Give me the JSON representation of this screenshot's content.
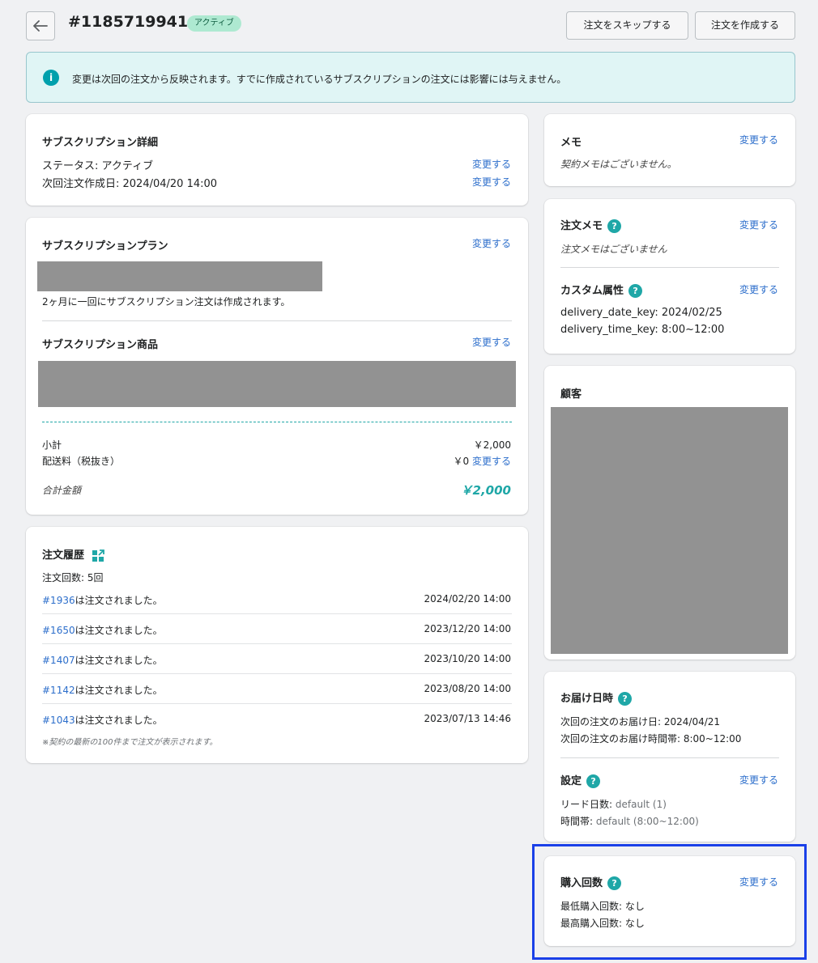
{
  "header": {
    "back_icon": "arrow-left-icon",
    "order_id": "#11857199414",
    "status_badge": "アクティブ",
    "skip_button": "注文をスキップする",
    "create_button": "注文を作成する"
  },
  "banner": {
    "icon": "info-icon",
    "text": "変更は次回の注文から反映されます。すでに作成されているサブスクリプションの注文には影響には与えません。"
  },
  "details": {
    "title": "サブスクリプション詳細",
    "status_line": "ステータス: アクティブ",
    "next_order_line": "次回注文作成日: 2024/04/20 14:00",
    "change": "変更する"
  },
  "plan": {
    "title": "サブスクリプションプラン",
    "change": "変更する",
    "description": "2ヶ月に一回にサブスクリプション注文は作成されます。",
    "products_title": "サブスクリプション商品",
    "subtotal_label": "小計",
    "subtotal_value": "￥2,000",
    "shipping_label": "配送料（税抜き）",
    "shipping_value": "￥0",
    "total_label": "合計金額",
    "total_value": "￥2,000"
  },
  "history": {
    "title": "注文履歴",
    "icon": "external-link-icon",
    "count_line": "注文回数: 5回",
    "ordered_suffix": "は注文されました。",
    "rows": [
      {
        "id": "#1936",
        "date": "2024/02/20 14:00"
      },
      {
        "id": "#1650",
        "date": "2023/12/20 14:00"
      },
      {
        "id": "#1407",
        "date": "2023/10/20 14:00"
      },
      {
        "id": "#1142",
        "date": "2023/08/20 14:00"
      },
      {
        "id": "#1043",
        "date": "2023/07/13 14:46"
      }
    ],
    "footnote": "※契約の最新の100件まで注文が表示されます。"
  },
  "memo": {
    "title": "メモ",
    "change": "変更する",
    "empty": "契約メモはございません。"
  },
  "order_memo": {
    "title": "注文メモ",
    "change": "変更する",
    "empty": "注文メモはございません",
    "custom_title": "カスタム属性",
    "attr1_key": "delivery_date_key:",
    "attr1_value": "2024/02/25",
    "attr2_key": "delivery_time_key:",
    "attr2_value": "8:00~12:00"
  },
  "customer": {
    "title": "顧客"
  },
  "delivery": {
    "title": "お届け日時",
    "next_date_line": "次回の注文のお届け日: 2024/04/21",
    "next_time_line": "次回の注文のお届け時間帯: 8:00~12:00",
    "settings_title": "設定",
    "change": "変更する",
    "lead_label": "リード日数:",
    "lead_value": "default (1)",
    "slot_label": "時間帯:",
    "slot_value": "default (8:00~12:00)"
  },
  "purchase_count": {
    "title": "購入回数",
    "change": "変更する",
    "min_line": "最低購入回数: なし",
    "max_line": "最高購入回数: なし"
  },
  "colors": {
    "accent": "#2c6ecb",
    "teal": "#1fa7a7",
    "highlight": "#1a40e8"
  }
}
